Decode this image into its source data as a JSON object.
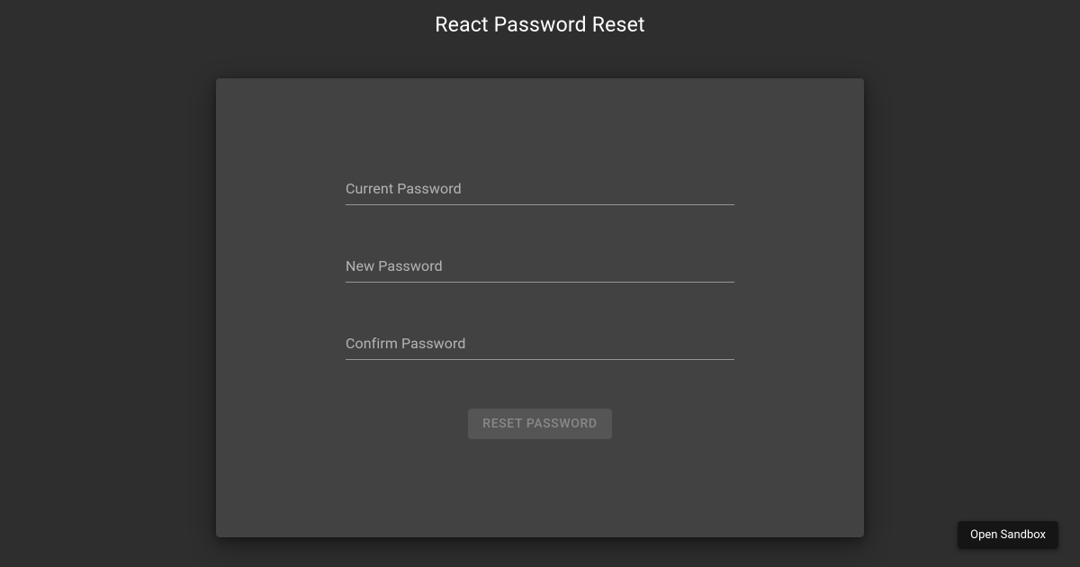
{
  "page": {
    "title": "React Password Reset"
  },
  "form": {
    "fields": {
      "current": {
        "label": "Current Password",
        "value": ""
      },
      "new": {
        "label": "New Password",
        "value": ""
      },
      "confirm": {
        "label": "Confirm Password",
        "value": ""
      }
    },
    "submit_label": "RESET PASSWORD"
  },
  "sandbox": {
    "open_label": "Open Sandbox"
  }
}
